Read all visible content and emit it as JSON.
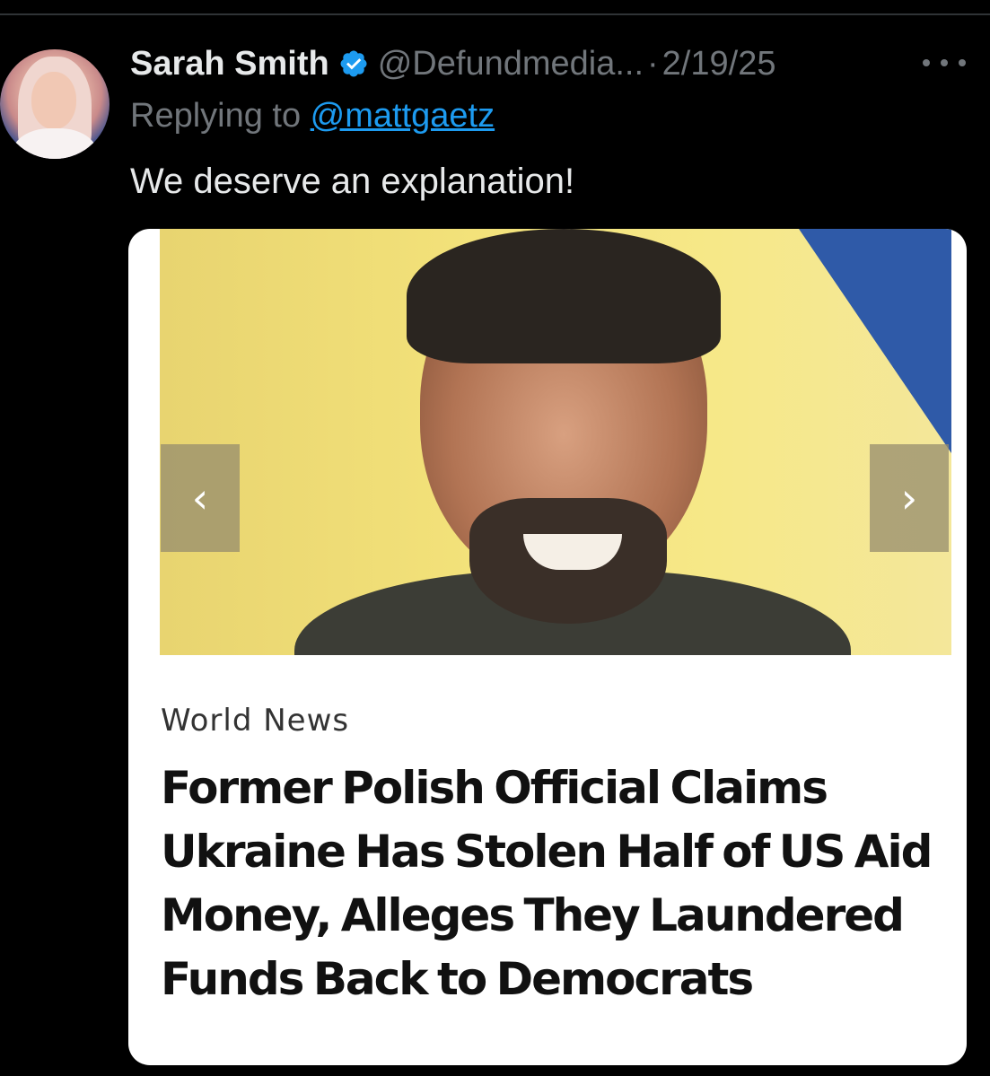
{
  "tweet": {
    "display_name": "Sarah Smith",
    "handle": "@Defundmedia...",
    "separator": "·",
    "date": "2/19/25",
    "reply_prefix": "Replying to ",
    "reply_to": "@mattgaetz",
    "text": "We deserve an explanation!"
  },
  "media": {
    "prev_glyph": "‹",
    "next_glyph": "›",
    "article": {
      "category": "World News",
      "headline": "Former Polish Official Claims Ukraine Has Stolen Half of US Aid Money, Alleges They Laundered Funds Back to Democrats"
    }
  },
  "icons": {
    "verified": "verified-badge-icon",
    "more": "more-options-icon"
  },
  "colors": {
    "background": "#000000",
    "primary_text": "#e7e9ea",
    "secondary_text": "#71767b",
    "link": "#1d9bf0",
    "verified": "#1d9bf0"
  }
}
